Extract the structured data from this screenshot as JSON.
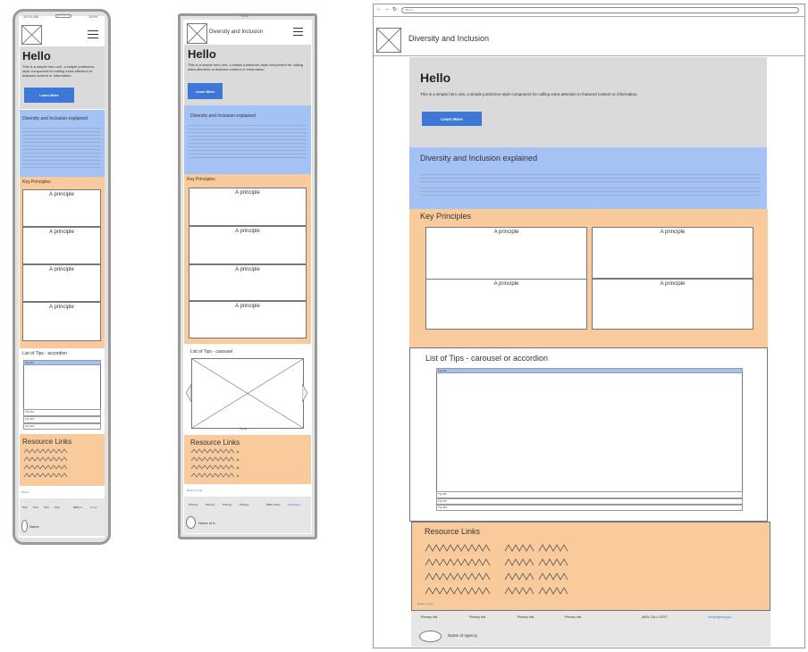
{
  "colors": {
    "hero_bg": "#dadada",
    "blue_section": "#a4c2f4",
    "orange_section": "#f9cb9c",
    "button": "#3d78d8",
    "link": "#3d78d8"
  },
  "mobile": {
    "status_time": "10:10 AM",
    "status_battery": "100%",
    "hero_title": "Hello",
    "hero_text": "This is a simple hero unit, a simple jumbotron-style component for calling extra attention to featured content or information.",
    "learn_more": "Learn More",
    "explained_title": "Diversity and Inclusion explained",
    "key_principles_title": "Key Principles",
    "principles": [
      "A principle",
      "A principle",
      "A principle",
      "A principle"
    ],
    "tips_title": "List of Tips - accordion",
    "tips_first": "Tip #1",
    "tips_rows": [
      "Tip #2",
      "Tip #3",
      "Tip #4"
    ],
    "resource_title": "Resource Links",
    "return_link": "Return",
    "footer_links": [
      "Prim",
      "Prim",
      "Prim",
      "Prim"
    ],
    "footer_phone": "(800) C",
    "footer_email": "info@",
    "agency": "Name"
  },
  "tablet": {
    "status_time": "10:10",
    "nav_title": "Diversity and Inclusion",
    "hero_title": "Hello",
    "hero_text": "This is a simple hero unit, a simple jumbotron-style component for calling extra attention to featured content or information.",
    "learn_more": "Learn More",
    "explained_title": "Diversity and Inclusion explained",
    "key_principles_title": "Key Principles",
    "principles": [
      "A principle",
      "A principle",
      "A principle",
      "A principle"
    ],
    "tips_title": "List of Tips - carousel",
    "carousel_caption": "Tip #1",
    "resource_title": "Resource Links",
    "return_link": "Return to top",
    "footer_links": [
      "Primary",
      "Primary",
      "Primary",
      "Primary"
    ],
    "footer_phone": "(800) CALL-",
    "footer_email": "info@agen",
    "agency": "Name of A"
  },
  "desktop": {
    "url": "https://",
    "nav_title": "Diversity and Inclusion",
    "hero_title": "Hello",
    "hero_text": "This is a simple hero unit, a simple jumbotron-style component for calling extra attention to featured content or information.",
    "learn_more": "Learn More",
    "explained_title": "Diversity and Inclusion explained",
    "key_principles_title": "Key Principles",
    "principles": [
      "A principle",
      "A principle",
      "A principle",
      "A principle"
    ],
    "tips_title": "List of Tips - carousel or accordion",
    "tips_first": "Tip #1",
    "tips_rows": [
      "Tip #2",
      "Tip #3",
      "Tip #4"
    ],
    "resource_title": "Resource Links",
    "return_link": "Return to top",
    "footer_links": [
      "Primary link",
      "Primary link",
      "Primary link",
      "Primary link"
    ],
    "footer_phone": "(800) CALL-GOVT",
    "footer_email": "info@agency.gov",
    "agency": "Name of Agency"
  }
}
